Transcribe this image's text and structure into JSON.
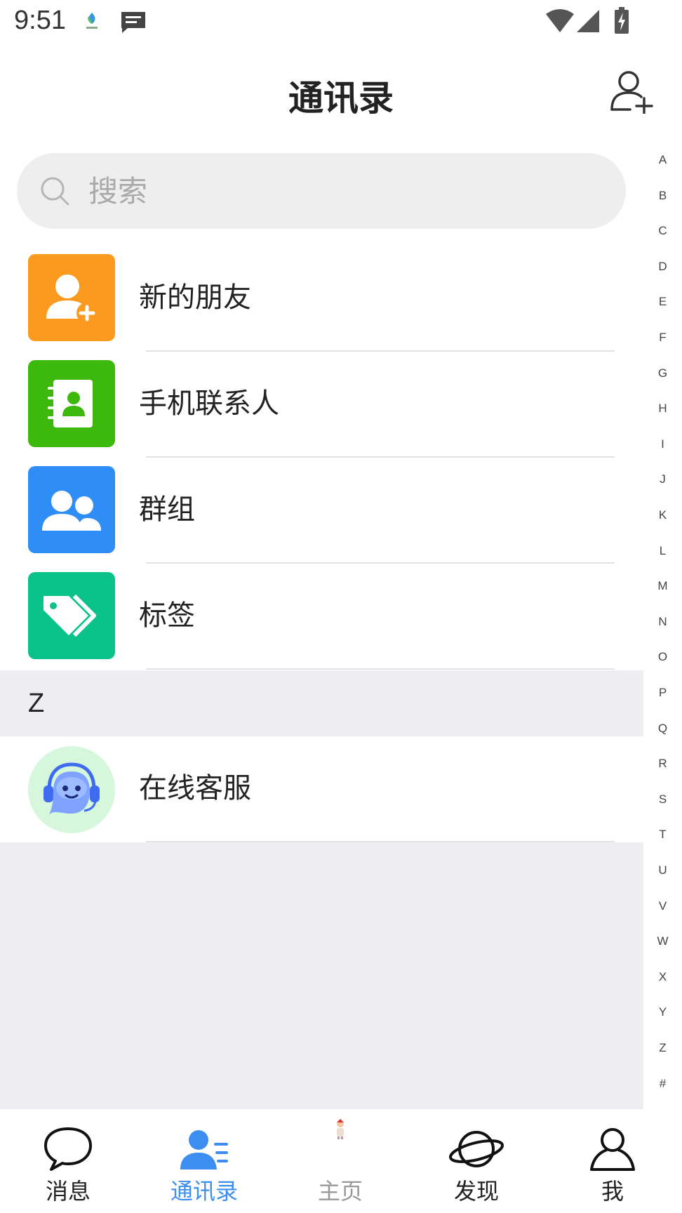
{
  "status_bar": {
    "time": "9:51"
  },
  "header": {
    "title": "通讯录"
  },
  "search": {
    "placeholder": "搜索"
  },
  "menu_items": [
    {
      "label": "新的朋友",
      "icon": "add-person-icon",
      "color": "#fb9a1e"
    },
    {
      "label": "手机联系人",
      "icon": "address-book-icon",
      "color": "#3db80c"
    },
    {
      "label": "群组",
      "icon": "group-icon",
      "color": "#2e8ef6"
    },
    {
      "label": "标签",
      "icon": "tag-icon",
      "color": "#0bc38a"
    }
  ],
  "sections": [
    {
      "letter": "Z",
      "contacts": [
        {
          "name": "在线客服",
          "avatar": "customer-service-robot-avatar"
        }
      ]
    }
  ],
  "index_letters": [
    "A",
    "B",
    "C",
    "D",
    "E",
    "F",
    "G",
    "H",
    "I",
    "J",
    "K",
    "L",
    "M",
    "N",
    "O",
    "P",
    "Q",
    "R",
    "S",
    "T",
    "U",
    "V",
    "W",
    "X",
    "Y",
    "Z",
    "#"
  ],
  "bottom_nav": [
    {
      "label": "消息",
      "icon": "chat-bubble-icon",
      "state": "normal"
    },
    {
      "label": "通讯录",
      "icon": "contacts-icon",
      "state": "active"
    },
    {
      "label": "主页",
      "icon": "home-icon",
      "state": "muted"
    },
    {
      "label": "发现",
      "icon": "planet-icon",
      "state": "normal"
    },
    {
      "label": "我",
      "icon": "profile-icon",
      "state": "normal"
    }
  ],
  "colors": {
    "accent": "#3d8ef0",
    "background_gray": "#eeeef2"
  }
}
